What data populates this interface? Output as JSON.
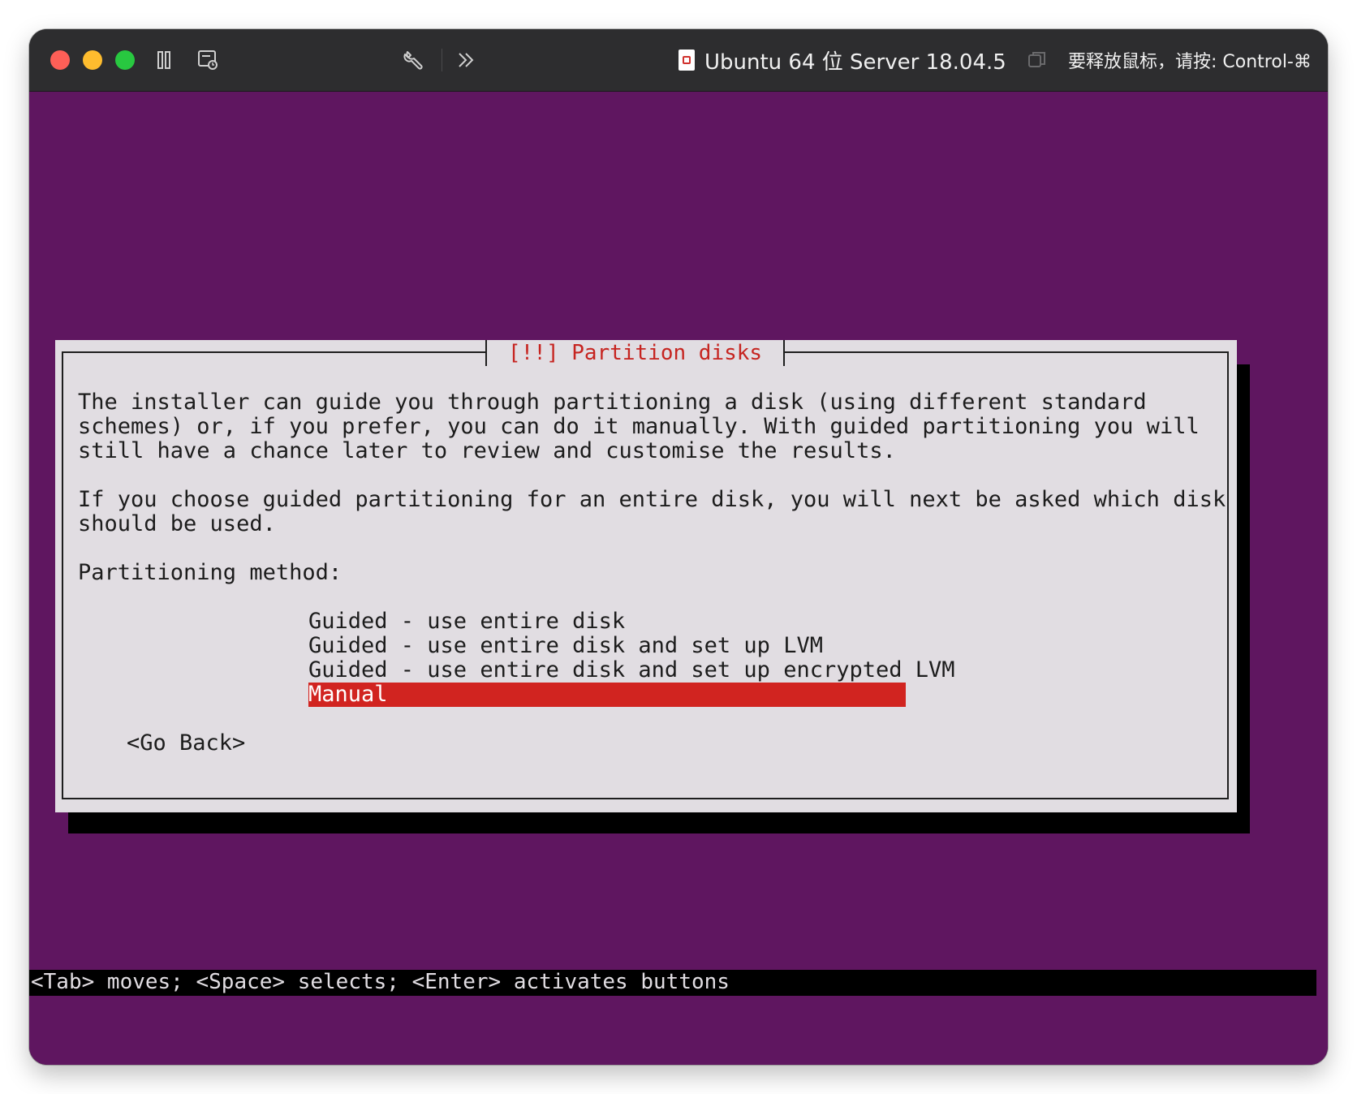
{
  "window": {
    "title": "Ubuntu 64 位 Server 18.04.5",
    "release_hint": "要释放鼠标，请按: Control-⌘"
  },
  "toolbar": {
    "icons": [
      "pause-icon",
      "snapshot-icon",
      "settings-wrench-icon",
      "more-chevrons-icon"
    ]
  },
  "dialog": {
    "title": "[!!] Partition disks",
    "paragraph1": "The installer can guide you through partitioning a disk (using different standard\nschemes) or, if you prefer, you can do it manually. With guided partitioning you will\nstill have a chance later to review and customise the results.",
    "paragraph2": "If you choose guided partitioning for an entire disk, you will next be asked which disk\nshould be used.",
    "method_label": "Partitioning method:",
    "options": [
      "Guided - use entire disk",
      "Guided - use entire disk and set up LVM",
      "Guided - use entire disk and set up encrypted LVM",
      "Manual"
    ],
    "selected_option": "Manual",
    "go_back": "<Go Back>"
  },
  "status_bar": {
    "text": "<Tab> moves; <Space> selects; <Enter> activates buttons"
  },
  "colors": {
    "background": "#5f1660",
    "dialog": "#e1dde2",
    "accent": "#d12420"
  }
}
